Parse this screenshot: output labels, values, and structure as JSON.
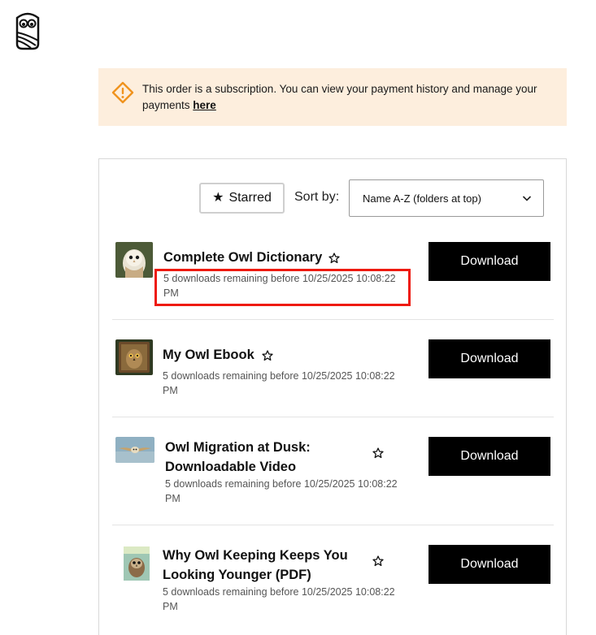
{
  "brand": {
    "logo_icon": "owl-logo-icon"
  },
  "notice": {
    "icon": "warning-diamond-icon",
    "text": "This order is a subscription. You can view your payment history and manage your payments ",
    "link": "here",
    "bg_color": "#fdeedd",
    "icon_color": "#f0931e"
  },
  "toolbar": {
    "starred_label": "Starred",
    "sort_label": "Sort by:",
    "sort_value": "Name A-Z (folders at top)"
  },
  "items": [
    {
      "title_line1": "Complete Owl Dictionary",
      "title_line2": "",
      "status": "5 downloads remaining before 10/25/2025 10:08:22 PM",
      "button": "Download"
    },
    {
      "title_line1": "My Owl Ebook",
      "title_line2": "",
      "status": "5 downloads remaining before 10/25/2025 10:08:22 PM",
      "button": "Download"
    },
    {
      "title_line1": "Owl Migration at Dusk:",
      "title_line2": "Downloadable Video",
      "status": "5 downloads remaining before 10/25/2025 10:08:22 PM",
      "button": "Download"
    },
    {
      "title_line1": "Why Owl Keeping Keeps You",
      "title_line2": "Looking Younger (PDF)",
      "status": "5 downloads remaining before 10/25/2025 10:08:22 PM",
      "button": "Download"
    }
  ],
  "colors": {
    "highlight": "#ee1a10",
    "button_bg": "#000000"
  }
}
